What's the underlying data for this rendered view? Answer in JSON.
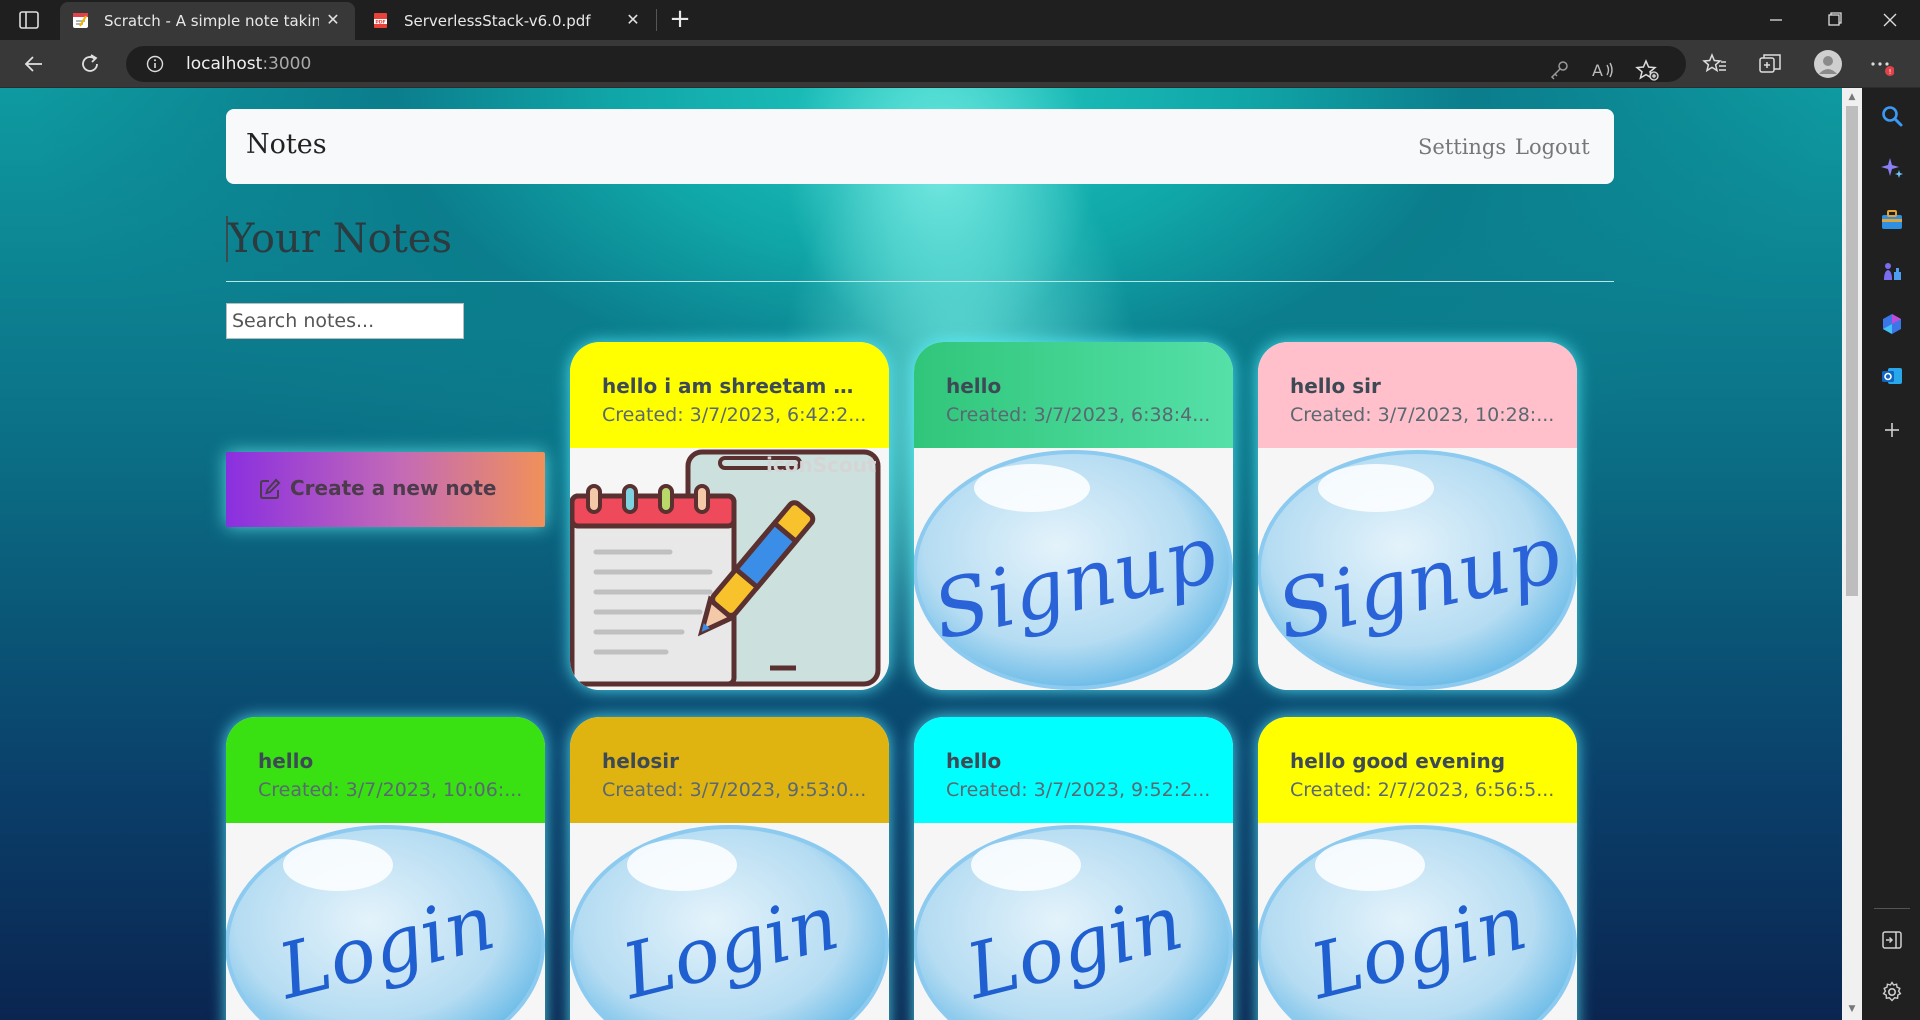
{
  "browser": {
    "tabs": [
      {
        "title": "Scratch - A simple note taking app",
        "active": true,
        "favicon": "notepad-favicon"
      },
      {
        "title": "ServerlessStack-v6.0.pdf",
        "active": false,
        "favicon": "pdf-favicon"
      }
    ],
    "url_host": "localhost",
    "url_port": ":3000"
  },
  "navbar": {
    "brand": "Notes",
    "links": [
      "Settings",
      "Logout"
    ]
  },
  "page": {
    "title": "Your Notes",
    "search_placeholder": "Search notes...",
    "new_note_label": "Create a new note"
  },
  "notes": [
    {
      "title": "hello i am shreetam mi...",
      "created": "Created: 3/7/2023, 6:42:2...",
      "color": "#ffff00",
      "image": "notepad-pen-icon"
    },
    {
      "title": "hello",
      "created": "Created: 3/7/2023, 6:38:4...",
      "color": "#3ad38a",
      "image": "Signup"
    },
    {
      "title": "hello sir",
      "created": "Created: 3/7/2023, 10:28:...",
      "color": "#ffc0cb",
      "image": "Signup"
    },
    {
      "title": "hello",
      "created": "Created: 3/7/2023, 10:06:...",
      "color": "#39e012",
      "image": "Login"
    },
    {
      "title": "helosir",
      "created": "Created: 3/7/2023, 9:53:0...",
      "color": "#e0b410",
      "image": "Login"
    },
    {
      "title": "hello",
      "created": "Created: 3/7/2023, 9:52:2...",
      "color": "#00ffff",
      "image": "Login"
    },
    {
      "title": "hello good evening",
      "created": "Created: 2/7/2023, 6:56:5...",
      "color": "#ffff00",
      "image": "Login"
    }
  ],
  "watermark": "iconScout"
}
